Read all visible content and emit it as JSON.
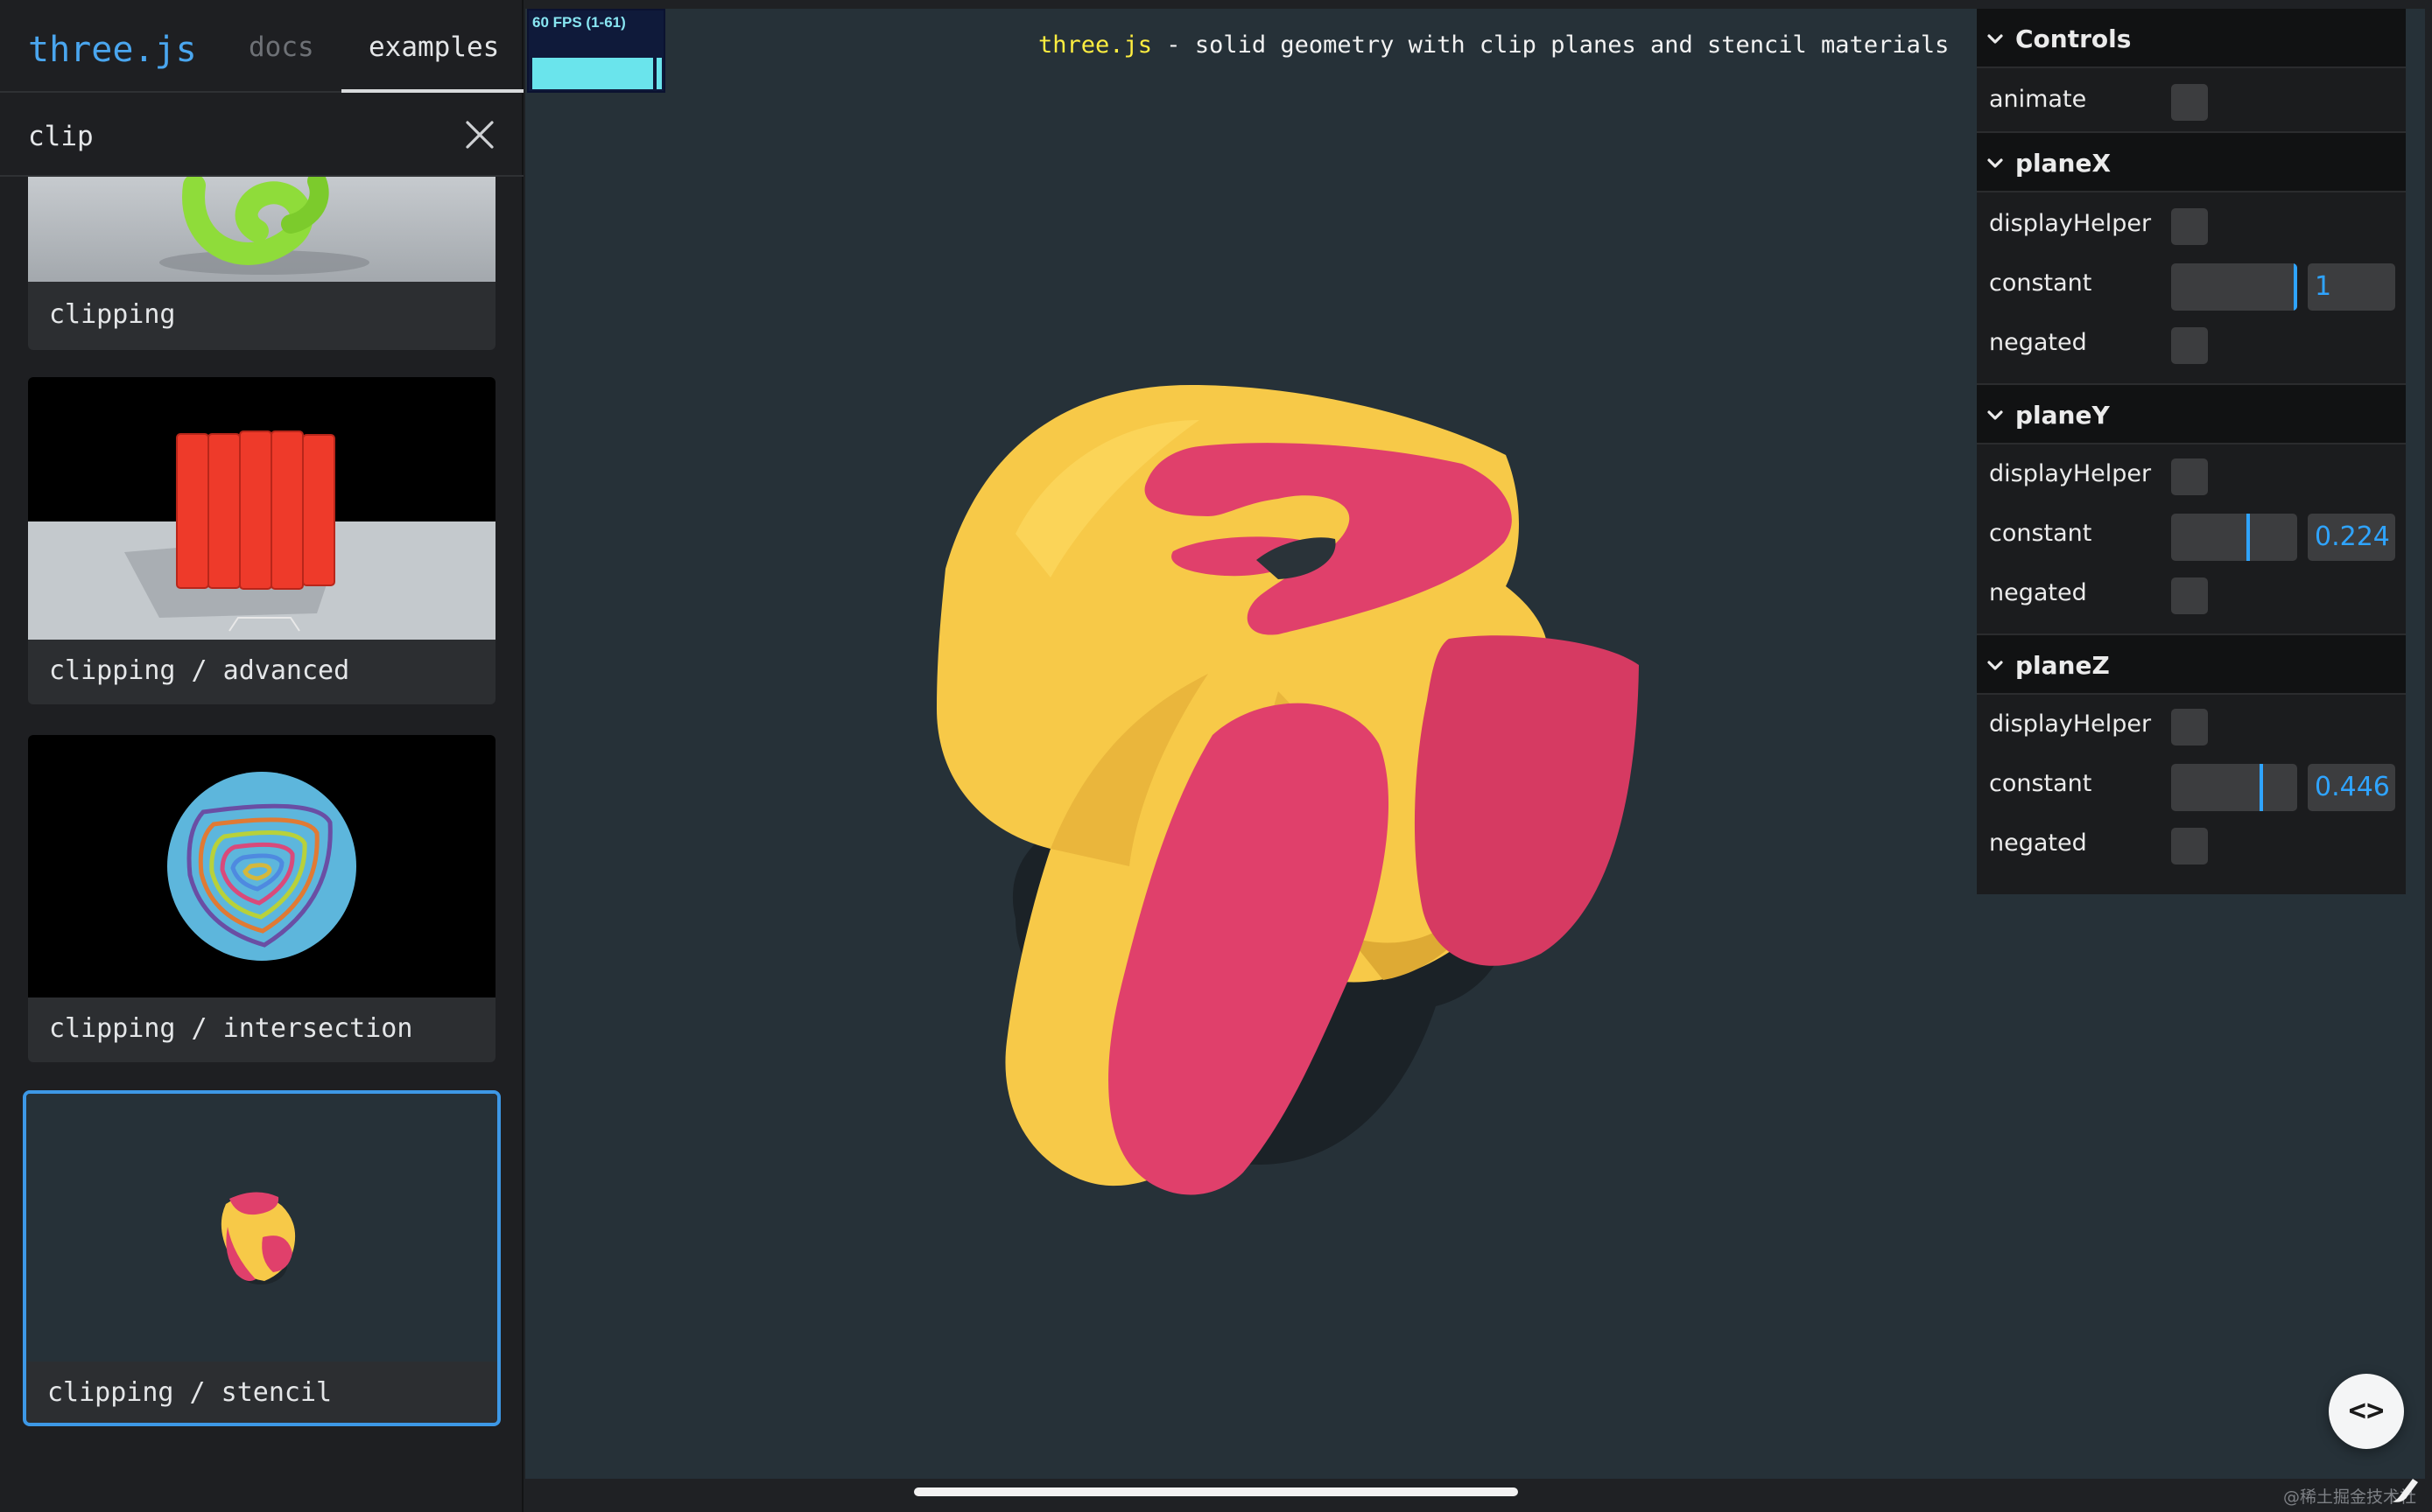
{
  "header": {
    "brand": "three.js",
    "tabs": [
      {
        "label": "docs",
        "active": false
      },
      {
        "label": "examples",
        "active": true
      }
    ]
  },
  "filter": {
    "value": "clip"
  },
  "examples": [
    {
      "label": "clipping",
      "selected": false
    },
    {
      "label": "clipping / advanced",
      "selected": false
    },
    {
      "label": "clipping / intersection",
      "selected": false
    },
    {
      "label": "clipping / stencil",
      "selected": true
    }
  ],
  "stats": {
    "label": "60 FPS (1-61)"
  },
  "info": {
    "link": "three.js",
    "text": " - solid geometry with clip planes and stencil materials"
  },
  "controls": {
    "title": "Controls",
    "animate_label": "animate",
    "folders": [
      {
        "title": "planeX",
        "display_helper": "displayHelper",
        "constant_label": "constant",
        "constant": "1",
        "negated": "negated",
        "level": 1.0
      },
      {
        "title": "planeY",
        "display_helper": "displayHelper",
        "constant_label": "constant",
        "constant": "0.224",
        "negated": "negated",
        "level": 0.612
      },
      {
        "title": "planeZ",
        "display_helper": "displayHelper",
        "constant_label": "constant",
        "constant": "0.446",
        "negated": "negated",
        "level": 0.723
      }
    ]
  },
  "watermark": "@稀土掘金技术社区",
  "colors": {
    "accent": "#3d98e6",
    "solid": "#f7c948",
    "cap": "#e0406b",
    "viewport_bg": "#263138"
  },
  "icons": {
    "clear": "close-icon",
    "folder": "chevron-down-icon",
    "code": "code-icon"
  }
}
